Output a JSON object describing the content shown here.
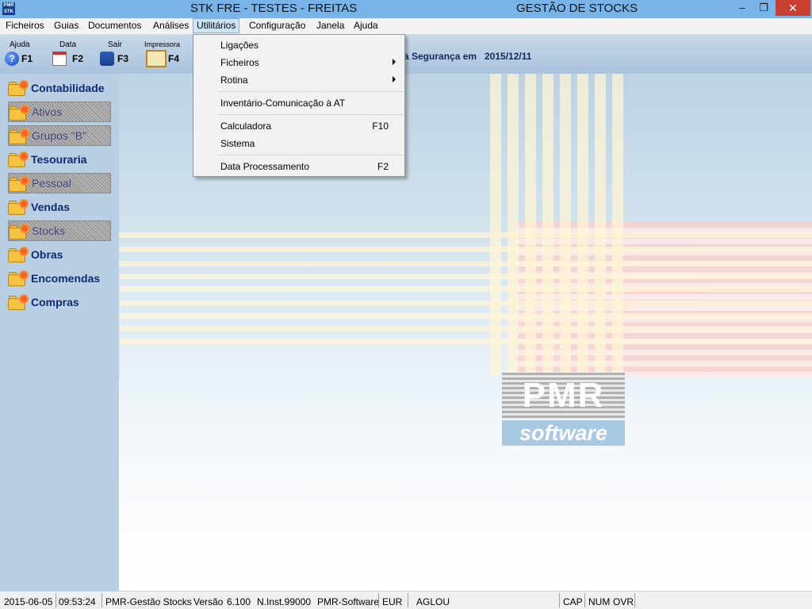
{
  "titlebar": {
    "icon_text_top": "PMR",
    "icon_text_bottom": "STK",
    "title": "STK FRE - TESTES - FREITAS",
    "subtitle": "GESTÃO DE STOCKS",
    "minimize": "‒",
    "maximize": "❐",
    "close": "✕"
  },
  "menubar": {
    "items": [
      "Ficheiros",
      "Guias",
      "Documentos",
      "Análises",
      "Utilitários",
      "Configuração",
      "Janela",
      "Ajuda"
    ],
    "active": "Utilitários"
  },
  "toolbar": {
    "tools": [
      {
        "label": "Ajuda",
        "key": "F1",
        "icon": "help-icon"
      },
      {
        "label": "Data",
        "key": "F2",
        "icon": "calendar-icon"
      },
      {
        "label": "Sair",
        "key": "F3",
        "icon": "exit-icon"
      },
      {
        "label": "Impressora",
        "key": "F4",
        "icon": "printer-icon"
      }
    ],
    "security_text": "a Segurança em",
    "security_date": "2015/12/11"
  },
  "sidebar": {
    "items": [
      {
        "label": "Contabilidade",
        "disabled": false
      },
      {
        "label": "Ativos",
        "disabled": true
      },
      {
        "label": "Grupos \"B\"",
        "disabled": true
      },
      {
        "label": "Tesouraria",
        "disabled": false
      },
      {
        "label": "Pessoal",
        "disabled": true
      },
      {
        "label": "Vendas",
        "disabled": false
      },
      {
        "label": "Stocks",
        "disabled": true
      },
      {
        "label": "Obras",
        "disabled": false
      },
      {
        "label": "Encomendas",
        "disabled": false
      },
      {
        "label": "Compras",
        "disabled": false
      }
    ]
  },
  "logo": {
    "pmr": "PMR",
    "software": "software"
  },
  "dropdown": {
    "items": [
      {
        "label": "Ligações",
        "shortcut": "",
        "submenu": false
      },
      {
        "label": "Ficheiros",
        "shortcut": "",
        "submenu": true
      },
      {
        "label": "Rotina",
        "shortcut": "",
        "submenu": true
      },
      {
        "label": "Inventário-Comunicação à AT",
        "shortcut": "",
        "submenu": false
      },
      {
        "label": "Calculadora",
        "shortcut": "F10",
        "submenu": false
      },
      {
        "label": "Sistema",
        "shortcut": "",
        "submenu": false
      },
      {
        "label": "Data Processamento",
        "shortcut": "F2",
        "submenu": false
      }
    ]
  },
  "statusbar": {
    "date": "2015-06-05",
    "time": "09:53:24",
    "app": "PMR-Gestão Stocks",
    "version_label": "Versão",
    "version": "6.100",
    "installation": "N.Inst.99000",
    "company": "PMR-Software",
    "currency": "EUR",
    "user": "AGLOU",
    "cap": "CAP",
    "num": "NUM",
    "ovr": "OVR"
  },
  "colors": {
    "titlebar": "#79b4e8",
    "sidebar": "#b9cfe4",
    "sidebar_text": "#0e2a72",
    "close_button": "#c84031",
    "menu_highlight": "#cce4f7"
  }
}
